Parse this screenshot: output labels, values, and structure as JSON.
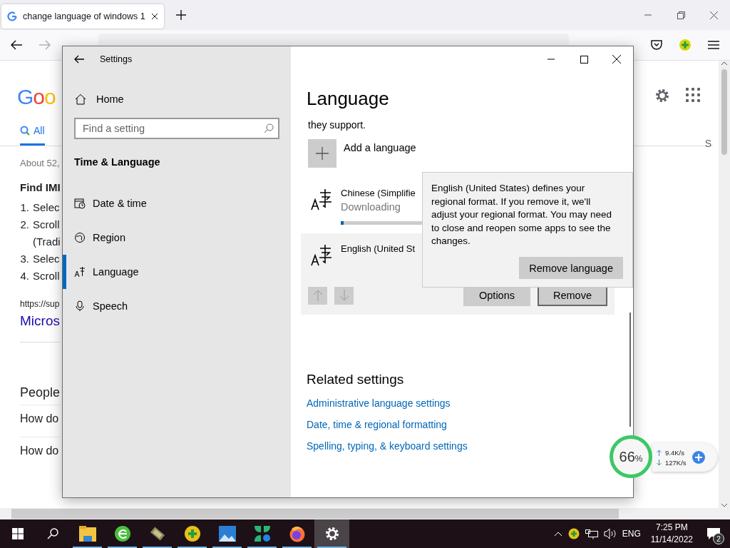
{
  "browser": {
    "tab": {
      "title": "change language of windows 1"
    }
  },
  "page": {
    "logo": "Goo",
    "tabs": [
      {
        "label": "All",
        "selected": true
      },
      {
        "label": "S",
        "selected": false
      }
    ],
    "result_count": "About 52,",
    "heading": "Find IMI",
    "steps": [
      {
        "number": "1.",
        "lines": [
          "Selec"
        ]
      },
      {
        "number": "2.",
        "lines": [
          "Scroll",
          "(Tradi"
        ]
      },
      {
        "number": "3.",
        "lines": [
          "Selec"
        ]
      },
      {
        "number": "4.",
        "lines": [
          "Scroll"
        ]
      }
    ],
    "source": "https://sup",
    "link": "Micros",
    "people_heading": "People",
    "questions": [
      "How do",
      "How do"
    ]
  },
  "settings": {
    "title": "Settings",
    "home": "Home",
    "search": {
      "placeholder": "Find a setting"
    },
    "section": "Time & Language",
    "nav": [
      {
        "kind": "clock",
        "label": "Date & time",
        "selected": false
      },
      {
        "kind": "globe",
        "label": "Region",
        "selected": false
      },
      {
        "kind": "language",
        "label": "Language",
        "selected": true
      },
      {
        "kind": "mic",
        "label": "Speech",
        "selected": false
      }
    ],
    "heading": "Language",
    "intro_tail": "they support.",
    "add_language": "Add a language",
    "languages": [
      {
        "name": "Chinese (Simplifie",
        "status": "Downloading",
        "level": 0.01,
        "highlighted": false
      },
      {
        "name": "English (United St",
        "highlighted": true
      }
    ],
    "move_buttons": [
      {
        "kind": "up",
        "disabled": true
      },
      {
        "kind": "down",
        "disabled": true
      }
    ],
    "actions": [
      {
        "label": "Options",
        "focused": false
      },
      {
        "label": "Remove",
        "focused": true
      }
    ],
    "popup": {
      "text": "English (United States) defines your regional format. If you remove it, we'll adjust your regional format. You may need to close and reopen some apps to see the changes.",
      "button": "Remove language"
    },
    "related_heading": "Related settings",
    "related_links": [
      "Administrative language settings",
      "Date, time & regional formatting",
      "Spelling, typing, & keyboard settings"
    ]
  },
  "widget": {
    "percent": "66",
    "unit": "%",
    "upload": "9.4K/s",
    "download": "127K/s"
  },
  "taskbar": {
    "apps": [
      {
        "kind": "folder",
        "running": true,
        "selected": false
      },
      {
        "kind": "browser-e",
        "running": true,
        "selected": false
      },
      {
        "kind": "chip",
        "running": true,
        "selected": false
      },
      {
        "kind": "plus",
        "running": true,
        "selected": false
      },
      {
        "kind": "photos",
        "running": true,
        "selected": false
      },
      {
        "kind": "tiles",
        "running": true,
        "selected": false
      },
      {
        "kind": "firefox",
        "running": true,
        "selected": false
      },
      {
        "kind": "gear",
        "running": true,
        "selected": true
      }
    ],
    "language": "ENG",
    "time": "7:25 PM",
    "date": "11/14/2022",
    "notifications": "2"
  }
}
